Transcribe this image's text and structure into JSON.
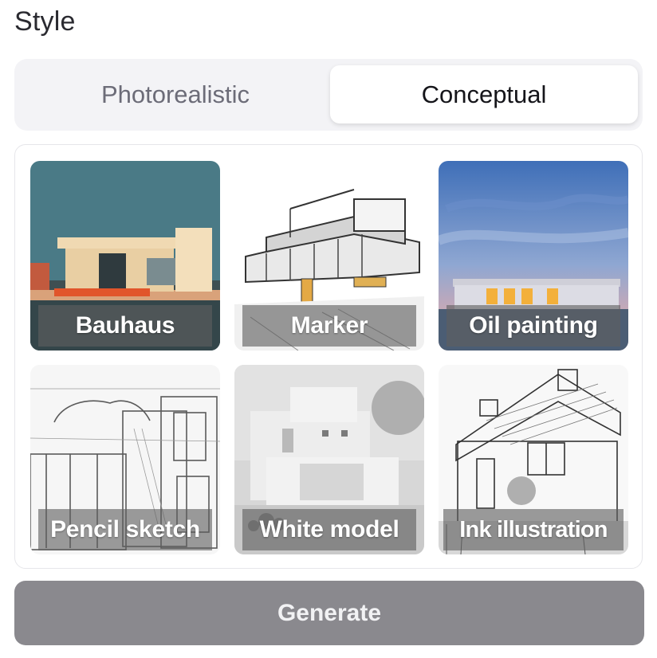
{
  "section_title": "Style",
  "tabs": [
    {
      "label": "Photorealistic",
      "selected": false
    },
    {
      "label": "Conceptual",
      "selected": true
    }
  ],
  "styles": [
    {
      "label": "Bauhaus"
    },
    {
      "label": "Marker"
    },
    {
      "label": "Oil painting"
    },
    {
      "label": "Pencil sketch"
    },
    {
      "label": "White model"
    },
    {
      "label": "Ink illustration"
    }
  ],
  "generate_label": "Generate",
  "colors": {
    "segment_bg": "#f3f3f6",
    "selected_tab_bg": "#ffffff",
    "generate_bg": "#8a898e",
    "label_overlay": "#5f5f5f"
  }
}
